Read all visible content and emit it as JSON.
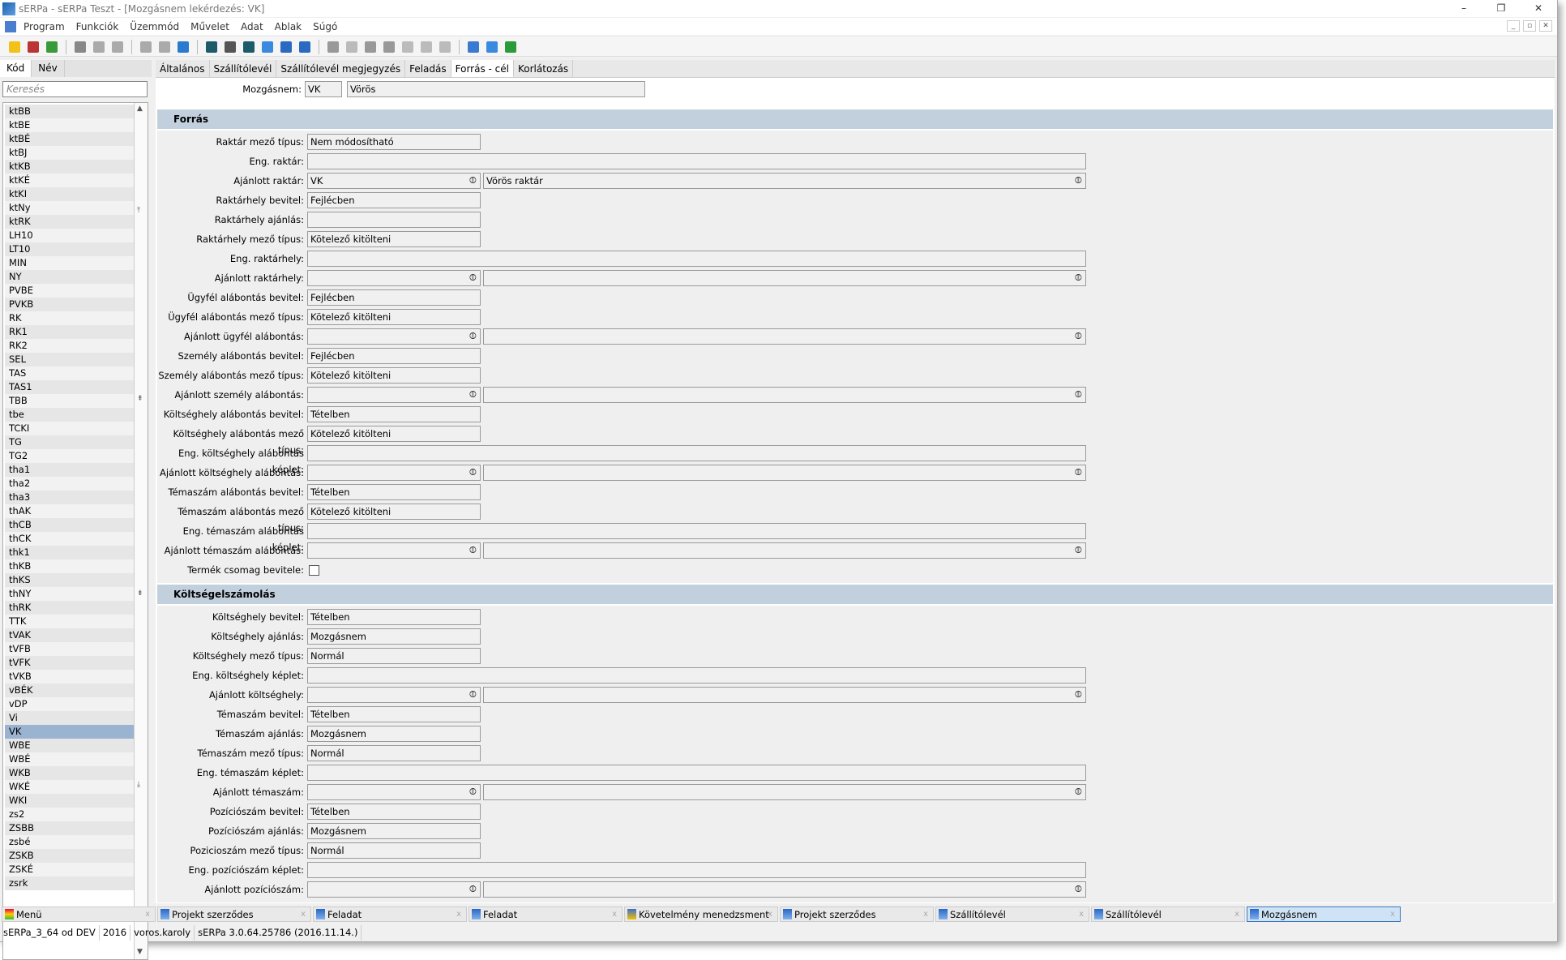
{
  "window": {
    "title": "sERPa - sERPa Teszt - [Mozgásnem lekérdezés: VK]",
    "controls": [
      "–",
      "❐",
      "✕"
    ],
    "mdi_controls": [
      "_",
      "▫",
      "✕"
    ]
  },
  "menu": [
    "Program",
    "Funkciók",
    "Üzemmód",
    "Művelet",
    "Adat",
    "Ablak",
    "Súgó"
  ],
  "toolbar": [
    {
      "icon": "new-star-icon",
      "color": "#f2c11a"
    },
    {
      "icon": "delete-icon",
      "color": "#b33"
    },
    {
      "icon": "refresh-icon",
      "color": "#3a9a3a"
    },
    "sep",
    {
      "icon": "print-icon",
      "color": "#888"
    },
    {
      "icon": "print-preview-icon",
      "color": "#aaa"
    },
    {
      "icon": "attach-icon",
      "color": "#aaa"
    },
    "sep",
    {
      "icon": "export-icon",
      "color": "#aaa"
    },
    {
      "icon": "export-excel-icon",
      "color": "#aaa"
    },
    {
      "icon": "import-icon",
      "color": "#2a7bd0"
    },
    "sep",
    {
      "icon": "filter-icon",
      "color": "#1d5a6a"
    },
    {
      "icon": "filter-dropdown-icon",
      "color": "#555"
    },
    {
      "icon": "filter-clear-icon",
      "color": "#1d5a6a"
    },
    {
      "icon": "search-icon",
      "color": "#3a8ae0"
    },
    {
      "icon": "sort-up-icon",
      "color": "#2a6ac0"
    },
    {
      "icon": "sort-down-icon",
      "color": "#2a6ac0"
    },
    "sep",
    {
      "icon": "indent-icon",
      "color": "#999"
    },
    {
      "icon": "edit-icon",
      "color": "#bbb"
    },
    {
      "icon": "move-in-icon",
      "color": "#999"
    },
    {
      "icon": "move-out-icon",
      "color": "#999"
    },
    {
      "icon": "add-icon",
      "color": "#bbb"
    },
    {
      "icon": "remove-icon",
      "color": "#bbb"
    },
    {
      "icon": "help-icon",
      "color": "#bbb"
    },
    "sep",
    {
      "icon": "calculator-icon",
      "color": "#3a7ad0"
    },
    {
      "icon": "email-icon",
      "color": "#3a8ae0"
    },
    {
      "icon": "phone-icon",
      "color": "#2a9a3a"
    }
  ],
  "left": {
    "tabs": [
      "Kód",
      "Név"
    ],
    "search_placeholder": "Keresés",
    "selected": "VK",
    "items": [
      "ktBB",
      "ktBE",
      "ktBÉ",
      "ktBJ",
      "ktKB",
      "ktKÉ",
      "ktKI",
      "ktNy",
      "ktRK",
      "LH10",
      "LT10",
      "MIN",
      "NY",
      "PVBE",
      "PVKB",
      "RK",
      "RK1",
      "RK2",
      "SEL",
      "TAS",
      "TAS1",
      "TBB",
      "tbe",
      "TCKI",
      "TG",
      "TG2",
      "tha1",
      "tha2",
      "tha3",
      "thAK",
      "thCB",
      "thCK",
      "thk1",
      "thKB",
      "thKS",
      "thNY",
      "thRK",
      "TTK",
      "tVAK",
      "tVFB",
      "tVFK",
      "tVKB",
      "vBÉK",
      "vDP",
      "Vi",
      "VK",
      "WBE",
      "WBÉ",
      "WKB",
      "WKÉ",
      "WKI",
      "zs2",
      "ZSBB",
      "zsbé",
      "ZSKB",
      "ZSKÉ",
      "zsrk"
    ]
  },
  "main": {
    "tabs": [
      "Általános",
      "Szállítólevél",
      "Szállítólevél megjegyzés",
      "Feladás",
      "Forrás - cél",
      "Korlátozás"
    ],
    "active_tab": "Forrás - cél",
    "header": {
      "label": "Mozgásnem:",
      "code": "VK",
      "name": "Vörös"
    },
    "sections": [
      {
        "title": "Forrás",
        "fields": [
          {
            "label": "Raktár mező típus:",
            "type": "short",
            "value": "Nem módosítható"
          },
          {
            "label": "Eng. raktár:",
            "type": "long",
            "value": ""
          },
          {
            "label": "Ajánlott raktár:",
            "type": "pair",
            "value": "VK",
            "value2": "Vörös raktár"
          },
          {
            "label": "Raktárhely bevitel:",
            "type": "short",
            "value": "Fejlécben"
          },
          {
            "label": "Raktárhely ajánlás:",
            "type": "short",
            "value": ""
          },
          {
            "label": "Raktárhely mező típus:",
            "type": "short",
            "value": "Kötelező kitölteni"
          },
          {
            "label": "Eng. raktárhely:",
            "type": "long",
            "value": ""
          },
          {
            "label": "Ajánlott raktárhely:",
            "type": "pair",
            "value": "",
            "value2": ""
          },
          {
            "label": "Ügyfél alábontás bevitel:",
            "type": "short",
            "value": "Fejlécben"
          },
          {
            "label": "Ügyfél alábontás mező típus:",
            "type": "short",
            "value": "Kötelező kitölteni"
          },
          {
            "label": "Ajánlott ügyfél alábontás:",
            "type": "pair",
            "value": "",
            "value2": ""
          },
          {
            "label": "Személy alábontás bevitel:",
            "type": "short",
            "value": "Fejlécben"
          },
          {
            "label": "Személy alábontás mező típus:",
            "type": "short",
            "value": "Kötelező kitölteni"
          },
          {
            "label": "Ajánlott személy alábontás:",
            "type": "pair",
            "value": "",
            "value2": ""
          },
          {
            "label": "Költséghely alábontás bevitel:",
            "type": "short",
            "value": "Tételben"
          },
          {
            "label": "Költséghely alábontás mező típus:",
            "type": "short",
            "value": "Kötelező kitölteni"
          },
          {
            "label": "Eng. költséghely alábontás képlet:",
            "type": "long",
            "value": ""
          },
          {
            "label": "Ajánlott költséghely alábontás:",
            "type": "pair",
            "value": "",
            "value2": ""
          },
          {
            "label": "Témaszám alábontás bevitel:",
            "type": "short",
            "value": "Tételben"
          },
          {
            "label": "Témaszám alábontás mező típus:",
            "type": "short",
            "value": "Kötelező kitölteni"
          },
          {
            "label": "Eng. témaszám alábontás képlet:",
            "type": "long",
            "value": ""
          },
          {
            "label": "Ajánlott témaszám alábontás:",
            "type": "pair",
            "value": "",
            "value2": ""
          },
          {
            "label": "Termék csomag bevitele:",
            "type": "checkbox",
            "checked": false
          }
        ]
      },
      {
        "title": "Költségelszámolás",
        "fields": [
          {
            "label": "Költséghely bevitel:",
            "type": "short",
            "value": "Tételben"
          },
          {
            "label": "Költséghely ajánlás:",
            "type": "short",
            "value": "Mozgásnem"
          },
          {
            "label": "Költséghely mező típus:",
            "type": "short",
            "value": "Normál"
          },
          {
            "label": "Eng. költséghely képlet:",
            "type": "long",
            "value": ""
          },
          {
            "label": "Ajánlott költséghely:",
            "type": "pair",
            "value": "",
            "value2": ""
          },
          {
            "label": "Témaszám bevitel:",
            "type": "short",
            "value": "Tételben"
          },
          {
            "label": "Témaszám ajánlás:",
            "type": "short",
            "value": "Mozgásnem"
          },
          {
            "label": "Témaszám mező típus:",
            "type": "short",
            "value": "Normál"
          },
          {
            "label": "Eng. témaszám képlet:",
            "type": "long",
            "value": ""
          },
          {
            "label": "Ajánlott témaszám:",
            "type": "pair",
            "value": "",
            "value2": ""
          },
          {
            "label": "Pozíciószám bevitel:",
            "type": "short",
            "value": "Tételben"
          },
          {
            "label": "Pozíciószám ajánlás:",
            "type": "short",
            "value": "Mozgásnem"
          },
          {
            "label": "Pozicioszám mező típus:",
            "type": "short",
            "value": "Normál"
          },
          {
            "label": "Eng. pozíciószám képlet:",
            "type": "long",
            "value": ""
          },
          {
            "label": "Ajánlott pozíciószám:",
            "type": "pair",
            "value": "",
            "value2": ""
          }
        ]
      }
    ]
  },
  "taskbar": [
    {
      "label": "Menü",
      "icon": "menu-icon"
    },
    {
      "label": "Projekt szerződes",
      "icon": "window-icon"
    },
    {
      "label": "Feladat",
      "icon": "window-icon"
    },
    {
      "label": "Feladat",
      "icon": "window-icon"
    },
    {
      "label": "Követelmény menedzsment",
      "icon": "warning-window-icon"
    },
    {
      "label": "Projekt szerződes",
      "icon": "window-icon"
    },
    {
      "label": "Szállítólevél",
      "icon": "window-icon"
    },
    {
      "label": "Szállítólevél",
      "icon": "window-icon"
    },
    {
      "label": "Mozgásnem",
      "icon": "window-icon",
      "active": true
    }
  ],
  "taskbar_close": "x",
  "status": [
    "sERPa_3_64 od DEV",
    "2016",
    "voros.karoly",
    "sERPa 3.0.64.25786 (2016.11.14.)"
  ]
}
